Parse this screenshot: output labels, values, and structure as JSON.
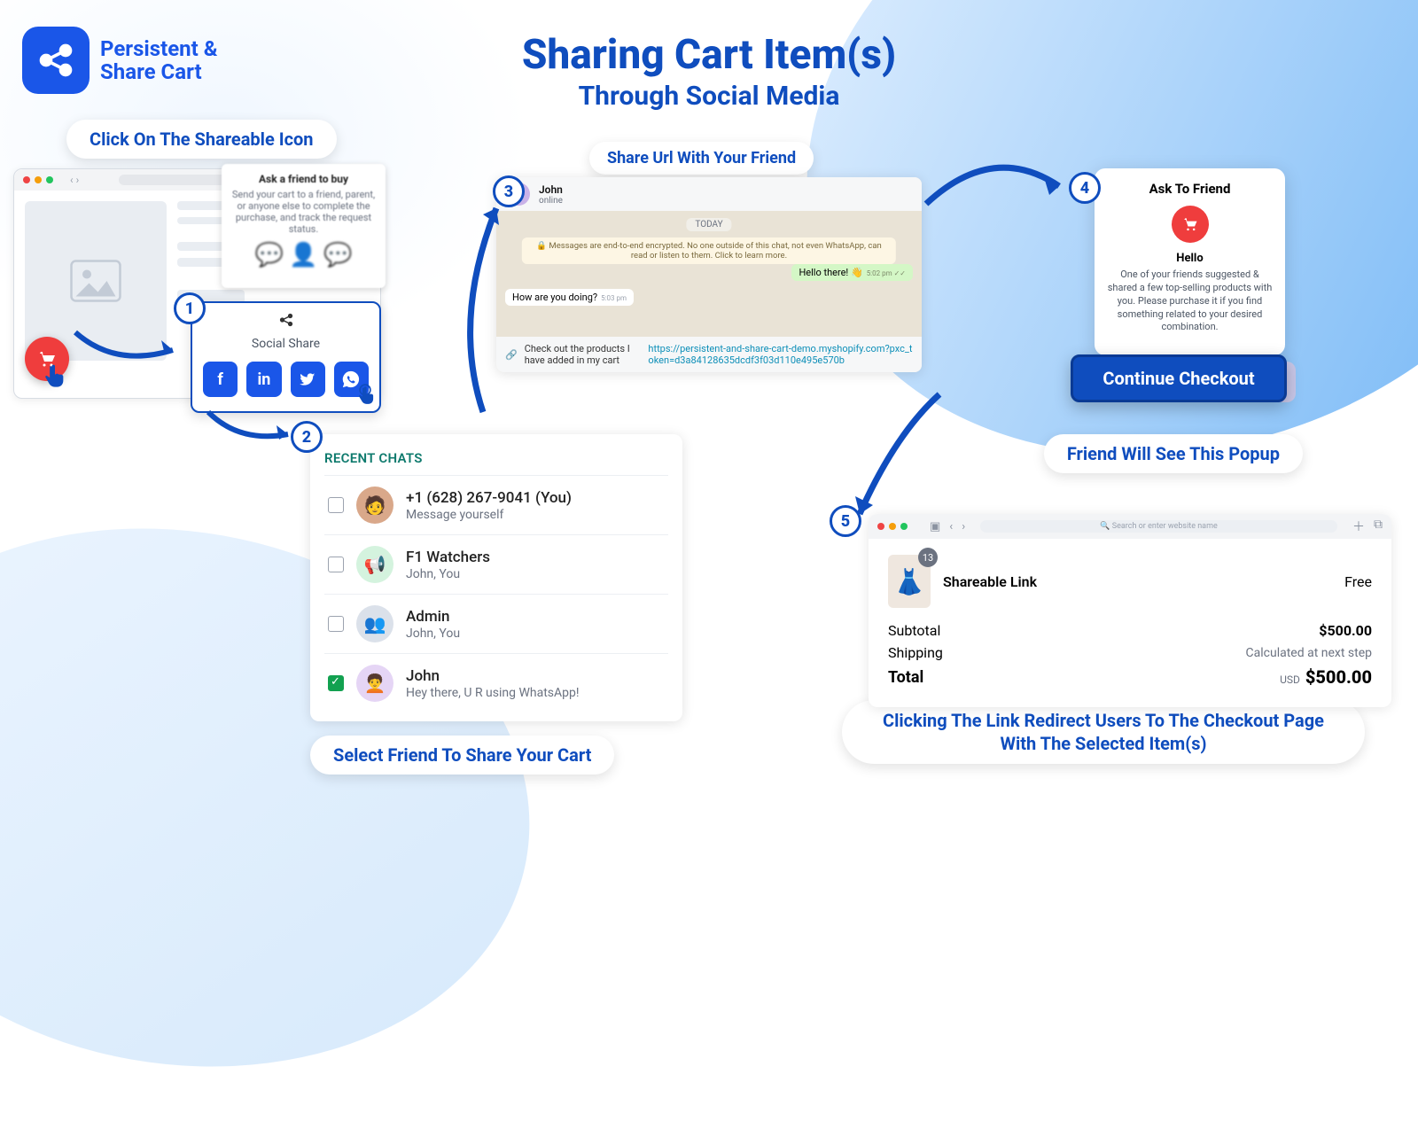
{
  "logo": {
    "line1": "Persistent &",
    "line2": "Share Cart"
  },
  "title": {
    "h1": "Sharing Cart Item(s)",
    "h2": "Through Social Media"
  },
  "captions": {
    "step1": "Click On The Shareable Icon",
    "step2": "Select Friend To Share Your Cart",
    "step3": "Share Url With Your Friend",
    "step4": "Friend Will See This Popup",
    "step5": "Clicking The Link Redirect Users To The Checkout Page With The Selected Item(s)"
  },
  "steps": {
    "s1": "1",
    "s2": "2",
    "s3": "3",
    "s4": "4",
    "s5": "5"
  },
  "popover1": {
    "title": "Ask a friend to buy",
    "desc": "Send your cart to a friend, parent, or anyone else to complete the purchase, and track the request status."
  },
  "social": {
    "label": "Social Share"
  },
  "chatlist": {
    "title": "RECENT CHATS",
    "items": [
      {
        "name": "+1 (628) 267-9041 (You)",
        "sub": "Message yourself"
      },
      {
        "name": "F1 Watchers",
        "sub": "John, You"
      },
      {
        "name": "Admin",
        "sub": "John, You"
      },
      {
        "name": "John",
        "sub": "Hey there, U R using WhatsApp!"
      }
    ]
  },
  "chat": {
    "name": "John",
    "status": "online",
    "today": "TODAY",
    "enc": "🔒 Messages are end-to-end encrypted. No one outside of this chat, not even WhatsApp, can read or listen to them. Click to learn more.",
    "out": "Hello there! 👋",
    "out_t": "5:02 pm ✓✓",
    "in": "How are you doing?",
    "in_t": "5:03 pm",
    "input_pre": "Check out the products I have added in my cart ",
    "input_url": "https://persistent-and-share-cart-demo.myshopify.com?pxc_token=d3a84128635dcdf3f03d110e495e570b"
  },
  "popup": {
    "title": "Ask To Friend",
    "hello": "Hello",
    "desc": "One of your friends suggested & shared a few top-selling products with you. Please purchase it if you find something related to your desired combination.",
    "cta": "Continue Checkout"
  },
  "checkout": {
    "search": "🔍 Search or enter website name",
    "badge": "13",
    "prod": "Shareable Link",
    "free": "Free",
    "subtotal_l": "Subtotal",
    "subtotal_v": "$500.00",
    "ship_l": "Shipping",
    "ship_v": "Calculated at next step",
    "total_l": "Total",
    "total_cur": "USD",
    "total_v": "$500.00"
  }
}
